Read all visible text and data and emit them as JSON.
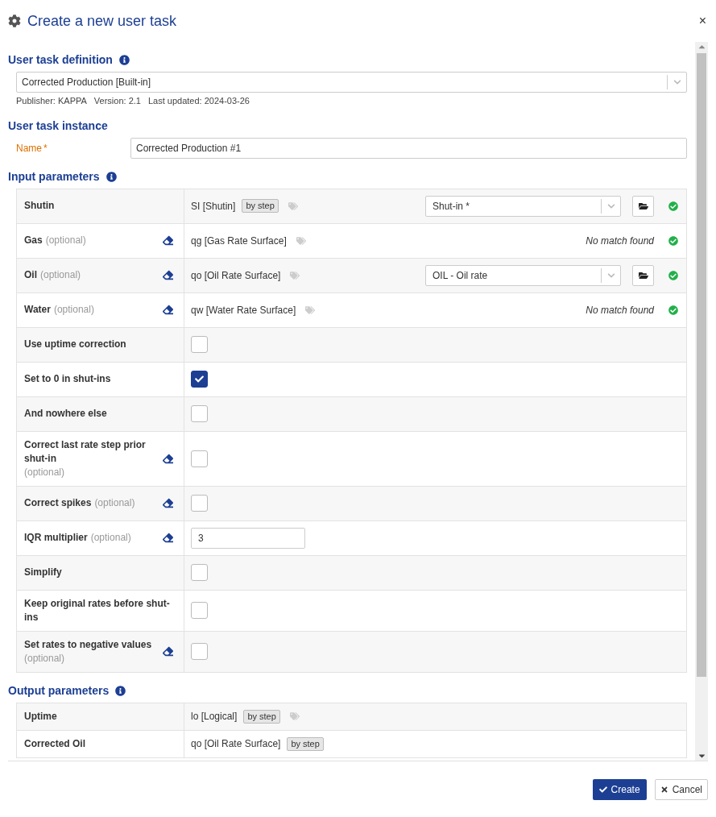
{
  "dialog": {
    "title": "Create a new user task",
    "close": "×"
  },
  "definition": {
    "heading": "User task definition",
    "value": "Corrected Production [Built-in]",
    "meta": [
      "Publisher: KAPPA",
      "Version: 2.1",
      "Last updated: 2024-03-26"
    ]
  },
  "instance": {
    "heading": "User task instance",
    "name_label": "Name",
    "required_mark": "*",
    "name_value": "Corrected Production #1"
  },
  "input_parameters": {
    "heading": "Input parameters",
    "rows": [
      {
        "kind": "series",
        "label": "Shutin",
        "clearable": false,
        "channel": "SI [Shutin]",
        "badge": "by step",
        "select": "Shut-in *",
        "valid": true
      },
      {
        "kind": "series",
        "label": "Gas",
        "optional": "(optional)",
        "clearable": true,
        "channel": "qg [Gas Rate Surface]",
        "status": "No match found",
        "valid": true
      },
      {
        "kind": "series",
        "label": "Oil",
        "optional": "(optional)",
        "clearable": true,
        "channel": "qo [Oil Rate Surface]",
        "select": "OIL - Oil rate",
        "valid": true
      },
      {
        "kind": "series",
        "label": "Water",
        "optional": "(optional)",
        "clearable": true,
        "channel": "qw [Water Rate Surface]",
        "status": "No match found",
        "valid": true
      },
      {
        "kind": "checkbox",
        "label": "Use uptime correction",
        "clearable": false,
        "checked": false
      },
      {
        "kind": "checkbox",
        "label": "Set to 0 in shut-ins",
        "clearable": false,
        "checked": true
      },
      {
        "kind": "checkbox",
        "label": "And nowhere else",
        "clearable": false,
        "checked": false
      },
      {
        "kind": "checkbox",
        "label": "Correct last rate step prior shut-in",
        "optional": "(optional)",
        "optional_below": true,
        "clearable": true,
        "checked": false
      },
      {
        "kind": "checkbox",
        "label": "Correct spikes",
        "optional": "(optional)",
        "clearable": true,
        "checked": false
      },
      {
        "kind": "number",
        "label": "IQR multiplier",
        "optional": "(optional)",
        "clearable": true,
        "value": "3"
      },
      {
        "kind": "checkbox",
        "label": "Simplify",
        "clearable": false,
        "checked": false
      },
      {
        "kind": "checkbox",
        "label": "Keep original rates before shut-ins",
        "clearable": false,
        "checked": false
      },
      {
        "kind": "checkbox",
        "label": "Set rates to negative values",
        "optional": "(optional)",
        "optional_below": true,
        "clearable": true,
        "checked": false
      }
    ]
  },
  "output_parameters": {
    "heading": "Output parameters",
    "rows": [
      {
        "label": "Uptime",
        "channel": "lo [Logical]",
        "badge": "by step",
        "tagged": true
      },
      {
        "label": "Corrected Oil",
        "channel": "qo [Oil Rate Surface]",
        "badge": "by step",
        "tagged": false
      }
    ]
  },
  "buttons": [
    {
      "kind": "primary",
      "label": "Create"
    },
    {
      "kind": "secondary",
      "label": "Cancel"
    }
  ]
}
